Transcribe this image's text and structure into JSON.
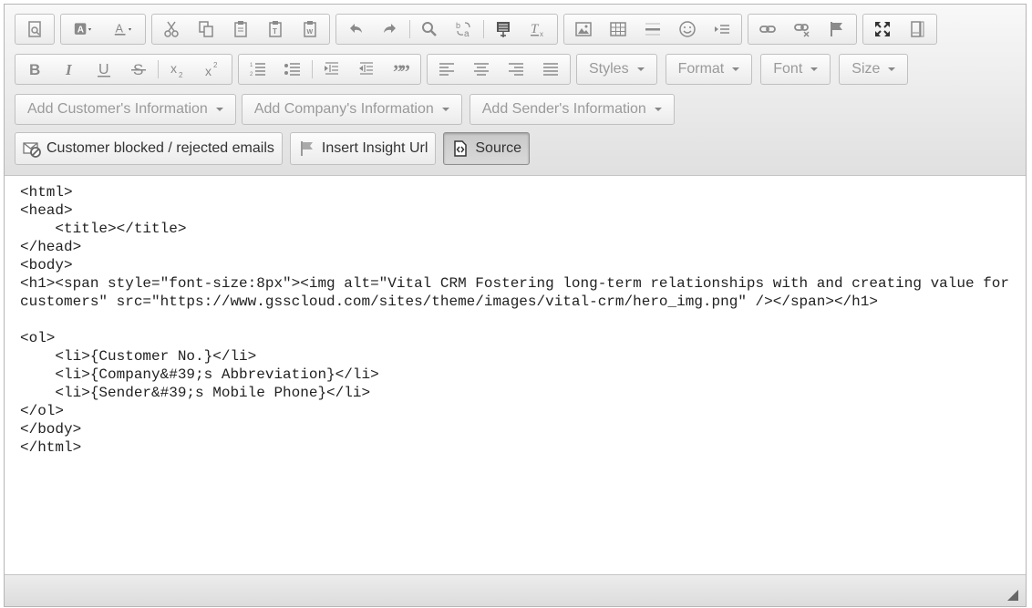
{
  "toolbar": {
    "formats": [
      {
        "label": "Styles"
      },
      {
        "label": "Format"
      },
      {
        "label": "Font"
      },
      {
        "label": "Size"
      }
    ],
    "insert_dropdowns": [
      {
        "label": "Add Customer's Information"
      },
      {
        "label": "Add Company's Information"
      },
      {
        "label": "Add Sender's Information"
      }
    ],
    "custom_buttons": [
      {
        "label": "Customer blocked / rejected emails"
      },
      {
        "label": "Insert Insight Url"
      },
      {
        "label": "Source"
      }
    ]
  },
  "source": {
    "text": "<html>\n<head>\n    <title></title>\n</head>\n<body>\n<h1><span style=\"font-size:8px\"><img alt=\"Vital CRM Fostering long-term relationships with and creating value for customers\" src=\"https://www.gsscloud.com/sites/theme/images/vital-crm/hero_img.png\" /></span></h1>\n\n<ol>\n    <li>{Customer No.}</li>\n    <li>{Company&#39;s Abbreviation}</li>\n    <li>{Sender&#39;s Mobile Phone}</li>\n</ol>\n</body>\n</html>"
  },
  "colors": {
    "toolbar_bg": "#e6e6e6",
    "icon": "#8a8a8a",
    "text": "#222222",
    "combo_text": "#9a9a9a"
  }
}
